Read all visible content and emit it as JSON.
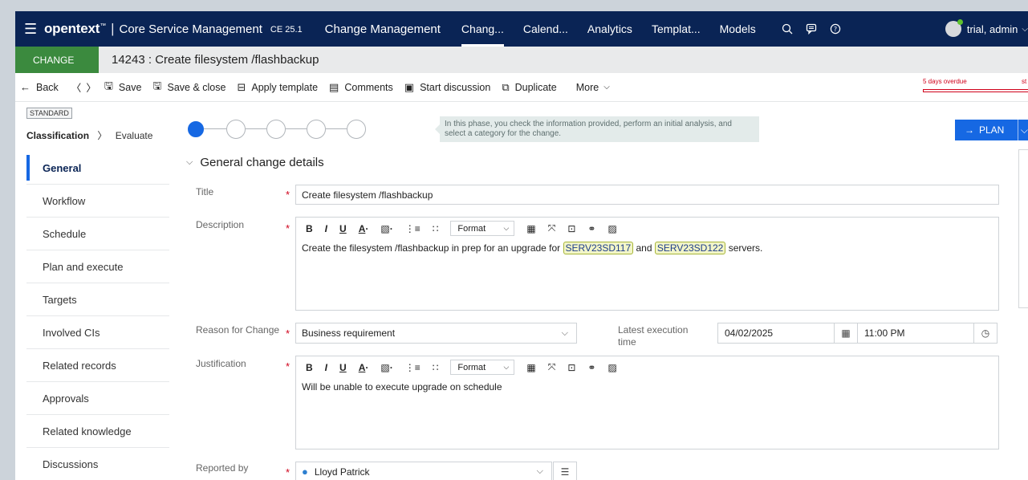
{
  "nav": {
    "brand": "opentext",
    "brand_mark": "™",
    "product": "Core Service Management",
    "version": "CE 25.1",
    "module": "Change Management",
    "links": [
      "Chang...",
      "Calend...",
      "Analytics",
      "Templat...",
      "Models"
    ],
    "active_link": 0,
    "user": "trial, admin"
  },
  "record": {
    "type": "CHANGE",
    "title": "14243 : Create filesystem /flashbackup"
  },
  "toolbar": {
    "back": "Back",
    "save": "Save",
    "save_close": "Save & close",
    "apply_template": "Apply template",
    "comments": "Comments",
    "start_discussion": "Start discussion",
    "duplicate": "Duplicate",
    "more": "More",
    "overdue": "5 days overdue",
    "overdue_right": "st"
  },
  "sidebar": {
    "badge": "STANDARD",
    "phase": "Classification",
    "next_phase": "Evaluate",
    "items": [
      "General",
      "Workflow",
      "Schedule",
      "Plan and execute",
      "Targets",
      "Involved CIs",
      "Related records",
      "Approvals",
      "Related knowledge",
      "Discussions"
    ],
    "active_item": 0
  },
  "phase": {
    "hint": "In this phase, you check the information provided, perform an initial analysis, and select a category for the change.",
    "next_button": "PLAN"
  },
  "form": {
    "section_title": "General change details",
    "title_label": "Title",
    "title_value": "Create filesystem /flashbackup",
    "description_label": "Description",
    "description_text_1": "Create the filesystem /flashbackup in prep for an upgrade for",
    "description_ci_1": "SERV23SD117",
    "description_text_2": "and",
    "description_ci_2": "SERV23SD122",
    "description_text_3": "servers.",
    "rte_format": "Format",
    "reason_label": "Reason for Change",
    "reason_value": "Business requirement",
    "latest_exec_label": "Latest execution time",
    "latest_exec_date": "04/02/2025",
    "latest_exec_time": "11:00 PM",
    "justification_label": "Justification",
    "justification_value": "Will be unable to execute upgrade on schedule",
    "reported_by_label": "Reported by",
    "reported_by_value": "Lloyd Patrick"
  }
}
